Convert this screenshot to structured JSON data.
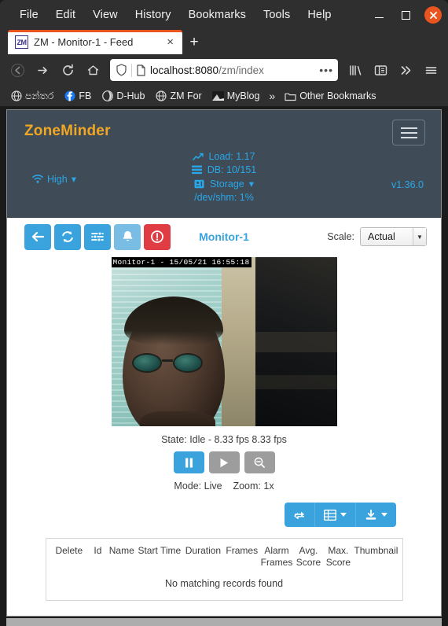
{
  "browser": {
    "menus": [
      "File",
      "Edit",
      "View",
      "History",
      "Bookmarks",
      "Tools",
      "Help"
    ],
    "window_controls": {
      "minimize": "minimize-button",
      "maximize": "maximize-button",
      "close": "close-button"
    },
    "tab": {
      "favicon_text": "ZM",
      "title": "ZM - Monitor-1 - Feed",
      "close": "×"
    },
    "new_tab": "+",
    "url": {
      "host": "localhost:8080",
      "path": "/zm/index"
    },
    "bookmarks": [
      {
        "label": "පන්තර",
        "icon": "globe-icon"
      },
      {
        "label": "FB",
        "icon": "facebook-icon"
      },
      {
        "label": "D-Hub",
        "icon": "globe-dark-icon"
      },
      {
        "label": "ZM For",
        "icon": "globe-icon"
      },
      {
        "label": "MyBlog",
        "icon": "image-icon"
      }
    ],
    "bookmarks_overflow": "»",
    "other_bookmarks": "Other Bookmarks"
  },
  "zoneminder": {
    "brand": "ZoneMinder",
    "bandwidth": "High",
    "bandwidth_caret": "▾",
    "version": "v1.36.0",
    "status": {
      "load": "Load: 1.17",
      "db": "DB: 10/151",
      "storage": "Storage",
      "storage_caret": "▾",
      "shm": "/dev/shm: 1%"
    },
    "toolbar": {
      "buttons": [
        {
          "name": "back-button",
          "icon": "arrow-left-icon",
          "style": "primary"
        },
        {
          "name": "refresh-button",
          "icon": "refresh-icon",
          "style": "primary"
        },
        {
          "name": "settings-sliders-button",
          "icon": "sliders-icon",
          "style": "primary"
        },
        {
          "name": "alarm-bell-button",
          "icon": "bell-icon",
          "style": "light"
        },
        {
          "name": "force-alarm-button",
          "icon": "alert-icon",
          "style": "danger"
        }
      ],
      "monitor_title": "Monitor-1",
      "scale_label": "Scale:",
      "scale_value": "Actual"
    },
    "feed": {
      "overlay": "Monitor-1 - 15/05/21 16:55:18",
      "state": "State: Idle - 8.33 fps 8.33 fps",
      "mode": "Mode: Live",
      "zoom": "Zoom: 1x",
      "controls": [
        {
          "name": "pause-button",
          "icon": "pause-icon",
          "active": true
        },
        {
          "name": "play-button",
          "icon": "play-icon",
          "active": false
        },
        {
          "name": "zoom-out-button",
          "icon": "zoom-out-icon",
          "active": false
        }
      ]
    },
    "events": {
      "buttons": [
        {
          "name": "refresh-events-button",
          "icon": "sync-icon",
          "caret": false
        },
        {
          "name": "column-visibility-button",
          "icon": "table-icon",
          "caret": true
        },
        {
          "name": "export-button",
          "icon": "download-icon",
          "caret": true
        }
      ],
      "columns": [
        "Delete",
        "Id",
        "Name",
        "Start Time",
        "Duration",
        "Frames",
        "Alarm Frames",
        "Avg. Score",
        "Max. Score",
        "Thumbnail"
      ],
      "empty_message": "No matching records found"
    }
  }
}
